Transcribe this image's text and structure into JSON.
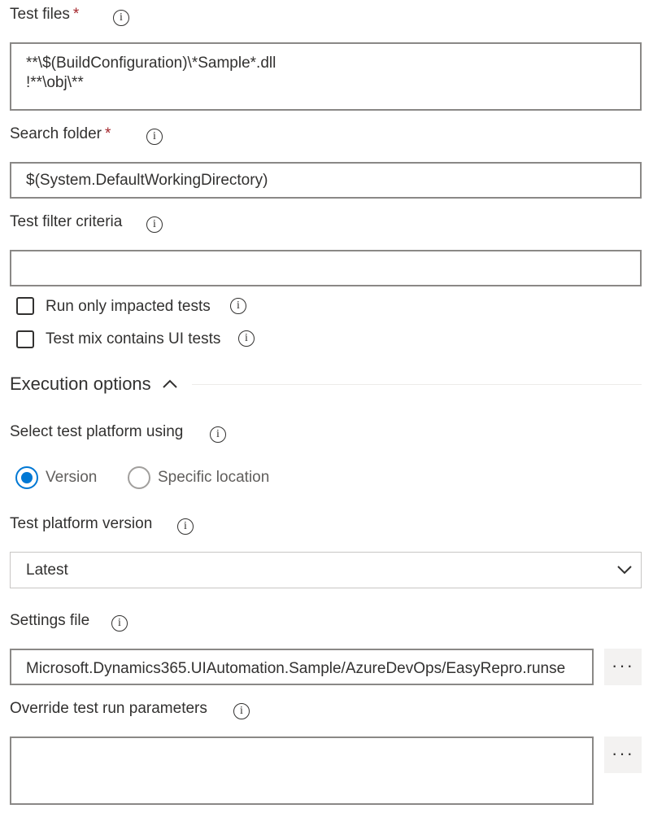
{
  "test_files": {
    "label": "Test files",
    "required_mark": "*",
    "lines": [
      "**\\$(BuildConfiguration)\\*Sample*.dll",
      "!**\\obj\\**"
    ]
  },
  "search_folder": {
    "label": "Search folder",
    "required_mark": "*",
    "value": "$(System.DefaultWorkingDirectory)"
  },
  "test_filter": {
    "label": "Test filter criteria",
    "value": ""
  },
  "checkboxes": {
    "impacted": "Run only impacted tests",
    "ui_tests": "Test mix contains UI tests"
  },
  "execution": {
    "title": "Execution options"
  },
  "platform": {
    "label": "Select test platform using",
    "options": [
      "Version",
      "Specific location"
    ],
    "selected": "Version"
  },
  "platform_version": {
    "label": "Test platform version",
    "value": "Latest"
  },
  "settings_file": {
    "label": "Settings file",
    "value": "Microsoft.Dynamics365.UIAutomation.Sample/AzureDevOps/EasyRepro.runse",
    "more": "···"
  },
  "override": {
    "label": "Override test run parameters",
    "value": "",
    "more": "···"
  },
  "colors": {
    "accent": "#0078d4",
    "border": "#8a8886",
    "text": "#323130",
    "required": "#a4262c",
    "disabled": "#605e5c"
  }
}
